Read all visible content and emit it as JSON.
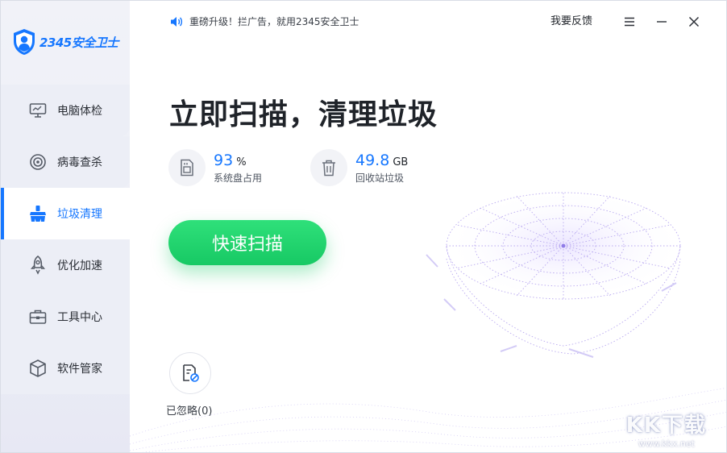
{
  "app": {
    "logo_text": "2345安全卫士"
  },
  "sidebar": {
    "items": [
      {
        "label": "电脑体检",
        "icon": "monitor-icon",
        "active": false
      },
      {
        "label": "病毒查杀",
        "icon": "target-icon",
        "active": false
      },
      {
        "label": "垃圾清理",
        "icon": "broom-icon",
        "active": true
      },
      {
        "label": "优化加速",
        "icon": "rocket-icon",
        "active": false
      },
      {
        "label": "工具中心",
        "icon": "toolbox-icon",
        "active": false
      },
      {
        "label": "软件管家",
        "icon": "box-icon",
        "active": false
      }
    ]
  },
  "topbar": {
    "notice": "重磅升级！拦广告，就用2345安全卫士",
    "feedback": "我要反馈"
  },
  "main": {
    "headline": "立即扫描，清理垃圾",
    "stats": [
      {
        "value": "93",
        "unit": "%",
        "label": "系统盘占用",
        "icon": "disk-icon"
      },
      {
        "value": "49.8",
        "unit": "GB",
        "label": "回收站垃圾",
        "icon": "trash-icon"
      }
    ],
    "scan_button": "快速扫描",
    "ignored_label": "已忽略(0)"
  },
  "watermark": {
    "big": "KK下载",
    "small": "www.kkx.net"
  },
  "colors": {
    "accent": "#1677ff",
    "scan_green": "#17c964",
    "sidebar_bg": "#eceef6"
  }
}
